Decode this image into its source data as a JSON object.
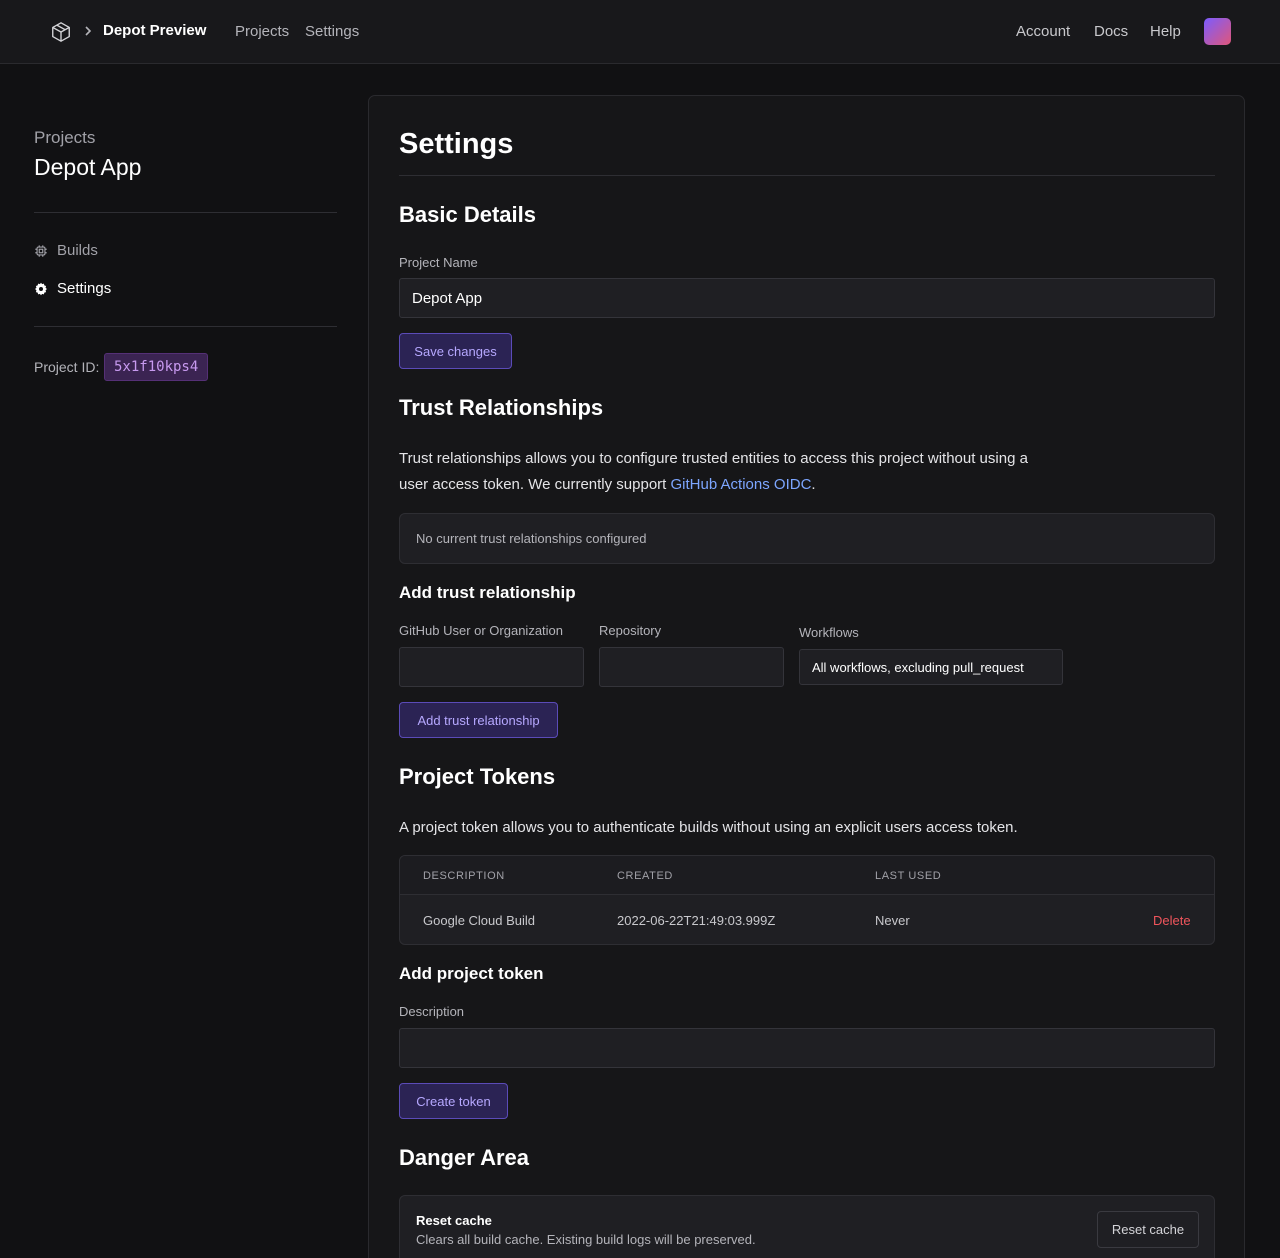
{
  "topnav": {
    "brand": "Depot Preview",
    "links": [
      "Projects",
      "Settings"
    ],
    "right_links": [
      "Account",
      "Docs",
      "Help"
    ]
  },
  "sidebar": {
    "section_label": "Projects",
    "project_name": "Depot App",
    "items": [
      {
        "label": "Builds",
        "icon": "chip-icon",
        "active": false
      },
      {
        "label": "Settings",
        "icon": "gear-icon",
        "active": true
      }
    ],
    "project_id_label": "Project ID:",
    "project_id": "5x1f10kps4"
  },
  "main": {
    "title": "Settings",
    "basic": {
      "heading": "Basic Details",
      "name_label": "Project Name",
      "name_value": "Depot App",
      "save_label": "Save changes"
    },
    "trust": {
      "heading": "Trust Relationships",
      "desc_line1": "Trust relationships allows you to configure trusted entities to access this project without using a",
      "desc_line2_pre": "user access token. We currently support ",
      "desc_link": "GitHub Actions OIDC",
      "desc_line2_post": ".",
      "empty_text": "No current trust relationships configured",
      "add_heading": "Add trust relationship",
      "org_label": "GitHub User or Organization",
      "repo_label": "Repository",
      "workflows_label": "Workflows",
      "workflows_value": "All workflows, excluding pull_request",
      "add_button": "Add trust relationship"
    },
    "tokens": {
      "heading": "Project Tokens",
      "desc": "A project token allows you to authenticate builds without using an explicit users access token.",
      "columns": [
        "DESCRIPTION",
        "CREATED",
        "LAST USED"
      ],
      "rows": [
        {
          "description": "Google Cloud Build",
          "created": "2022-06-22T21:49:03.999Z",
          "last_used": "Never",
          "action": "Delete"
        }
      ],
      "add_heading": "Add project token",
      "desc_label": "Description",
      "create_button": "Create token"
    },
    "danger": {
      "heading": "Danger Area",
      "reset_title": "Reset cache",
      "reset_desc": "Clears all build cache. Existing build logs will be preserved.",
      "reset_button": "Reset cache"
    }
  },
  "colors": {
    "accent": "#b6a8ff",
    "link": "#7da6ff",
    "danger": "#f0555c"
  }
}
